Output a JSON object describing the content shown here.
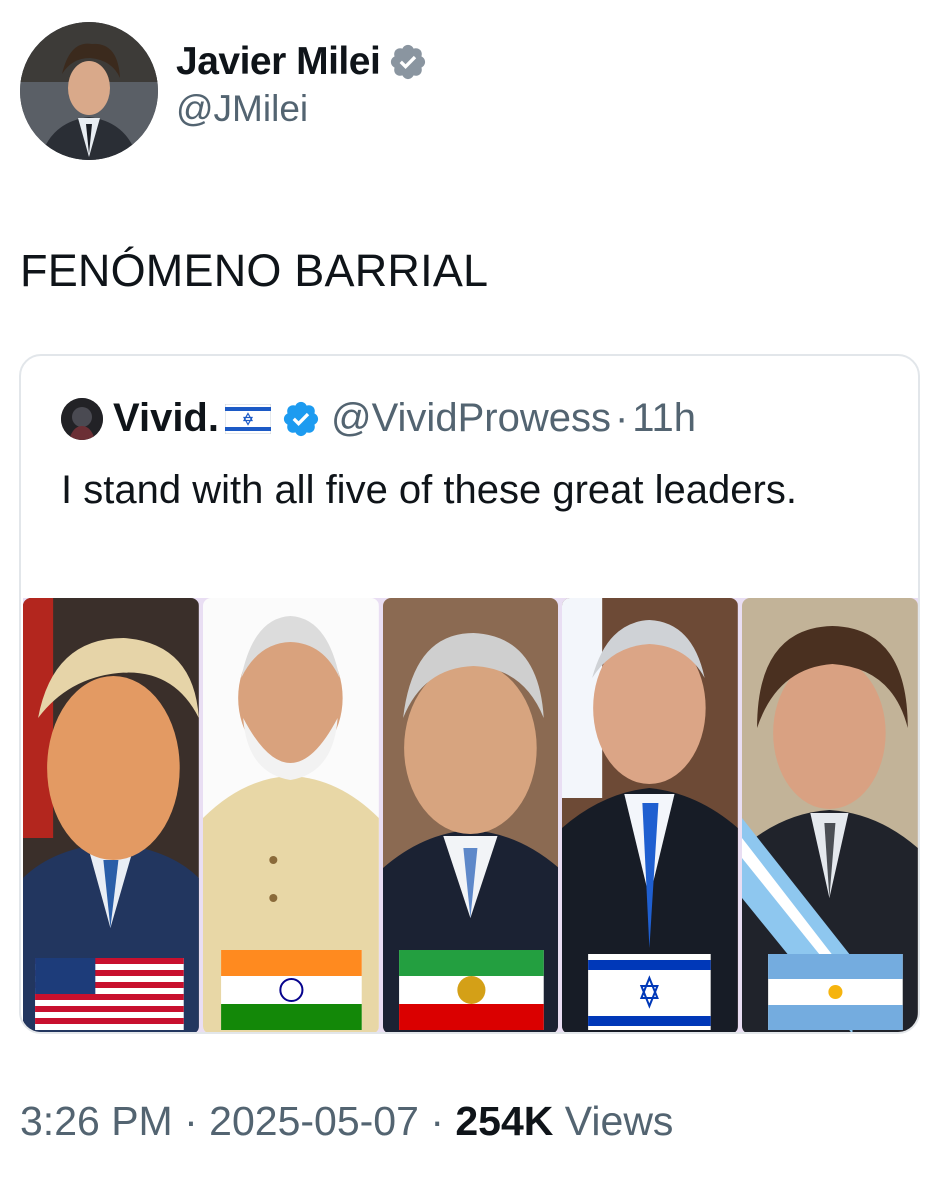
{
  "author": {
    "name": "Javier Milei",
    "handle": "@JMilei",
    "verified_icon": "verified-badge-icon"
  },
  "tweet": {
    "text": "FENÓMENO BARRIAL"
  },
  "quoted_tweet": {
    "name": "Vivid.",
    "flag": "israel-flag-emoji",
    "handle": "@VividProwess",
    "separator": "·",
    "time": "11h",
    "text": "I stand with all five of these great leaders.",
    "image_panels": [
      {
        "flag": "united-states-flag"
      },
      {
        "flag": "india-flag"
      },
      {
        "flag": "iran-lion-and-sun-flag"
      },
      {
        "flag": "israel-flag"
      },
      {
        "flag": "argentina-flag"
      }
    ]
  },
  "meta": {
    "time": "3:26 PM",
    "sep1": "·",
    "date": "2025-05-07",
    "sep2": "·",
    "views_count": "254K",
    "views_label": "Views"
  },
  "colors": {
    "verified_blue": "#1d9bf0",
    "muted_text": "#536471",
    "border": "#e2e6ea"
  }
}
